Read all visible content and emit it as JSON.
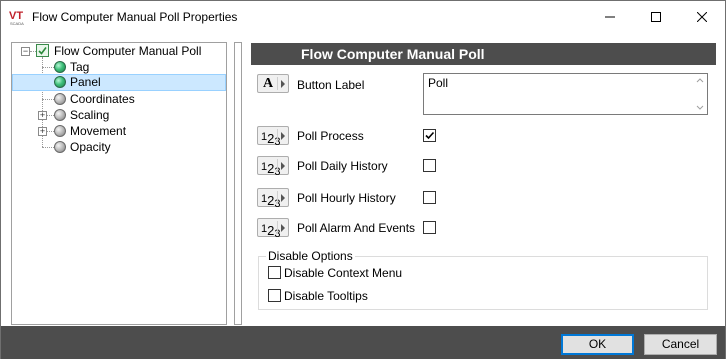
{
  "window": {
    "title": "Flow Computer Manual Poll Properties",
    "logo_text": "VT",
    "logo_subtext": "SCADA"
  },
  "tree": {
    "root_label": "Flow Computer Manual Poll",
    "items": [
      {
        "label": "Tag",
        "icon": "green-orb-icon",
        "selected": false,
        "expandable": false
      },
      {
        "label": "Panel",
        "icon": "green-orb-icon",
        "selected": true,
        "expandable": false
      },
      {
        "label": "Coordinates",
        "icon": "gray-orb-icon",
        "selected": false,
        "expandable": false
      },
      {
        "label": "Scaling",
        "icon": "gray-orb-icon",
        "selected": false,
        "expandable": true
      },
      {
        "label": "Movement",
        "icon": "gray-orb-icon",
        "selected": false,
        "expandable": true
      },
      {
        "label": "Opacity",
        "icon": "gray-orb-icon",
        "selected": false,
        "expandable": false
      }
    ]
  },
  "panel": {
    "header": "Flow Computer Manual Poll",
    "button_label": {
      "label": "Button Label",
      "value": "Poll",
      "type_icon": "A"
    },
    "properties": [
      {
        "label": "Poll Process",
        "checked": true,
        "type_icon": "123"
      },
      {
        "label": "Poll Daily History",
        "checked": false,
        "type_icon": "123"
      },
      {
        "label": "Poll Hourly History",
        "checked": false,
        "type_icon": "123"
      },
      {
        "label": "Poll Alarm And Events",
        "checked": false,
        "type_icon": "123"
      }
    ],
    "disable_options": {
      "title": "Disable Options",
      "items": [
        {
          "label": "Disable Context Menu",
          "checked": false
        },
        {
          "label": "Disable Tooltips",
          "checked": false
        }
      ]
    }
  },
  "footer": {
    "ok_label": "OK",
    "cancel_label": "Cancel"
  },
  "colors": {
    "header_bg": "#4d4d4d",
    "selection_bg": "#cce8ff",
    "default_button_border": "#0078d7"
  }
}
